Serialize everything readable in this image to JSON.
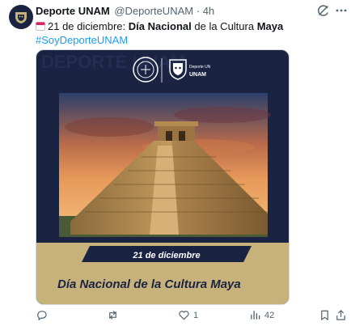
{
  "author": {
    "name": "Deporte UNAM",
    "handle": "@DeporteUNAM",
    "separator": "·",
    "time": "4h"
  },
  "post": {
    "date_prefix": "21 de diciembre: ",
    "bold_1": "Día Nacional",
    "mid": " de la Cultura ",
    "bold_2": "Maya",
    "hashtag": "#SoyDeporteUNAM"
  },
  "media": {
    "watermark_text": "DEPORTE UNAM",
    "logo_caption_top": "Deporte UN",
    "logo_caption_bottom": "UNAM",
    "date_banner": "21 de diciembre",
    "title": "Día Nacional de la Cultura Maya"
  },
  "metrics": {
    "reply_count": "",
    "repost_count": "",
    "like_count": "1",
    "view_count": "42"
  },
  "colors": {
    "navy": "#1a2342",
    "gold": "#c8b27c",
    "link": "#1d9bf0"
  },
  "icons": [
    "unam-avatar-icon",
    "grok-icon",
    "more-icon",
    "calendar-icon",
    "reply-icon",
    "repost-icon",
    "like-icon",
    "views-icon",
    "bookmark-icon",
    "share-icon"
  ]
}
